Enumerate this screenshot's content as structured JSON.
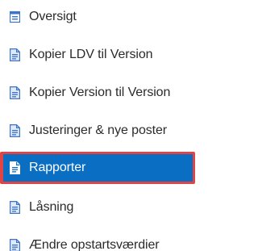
{
  "colors": {
    "icon_blue": "#3f73c8",
    "active_background": "#0a6fc2",
    "active_highlight_border": "#e04545",
    "text": "#2b2b2b",
    "active_text": "#ffffff"
  },
  "menu": {
    "items": [
      {
        "label": "Oversigt",
        "icon": "overview-icon",
        "active": false
      },
      {
        "label": "Kopier LDV til Version",
        "icon": "document-icon",
        "active": false
      },
      {
        "label": "Kopier Version til Version",
        "icon": "document-icon",
        "active": false
      },
      {
        "label": "Justeringer & nye poster",
        "icon": "document-icon",
        "active": false
      },
      {
        "label": "Rapporter",
        "icon": "document-icon",
        "active": true
      },
      {
        "label": "Låsning",
        "icon": "document-icon",
        "active": false
      },
      {
        "label": "Ændre opstartsværdier",
        "icon": "document-icon",
        "active": false
      }
    ]
  }
}
